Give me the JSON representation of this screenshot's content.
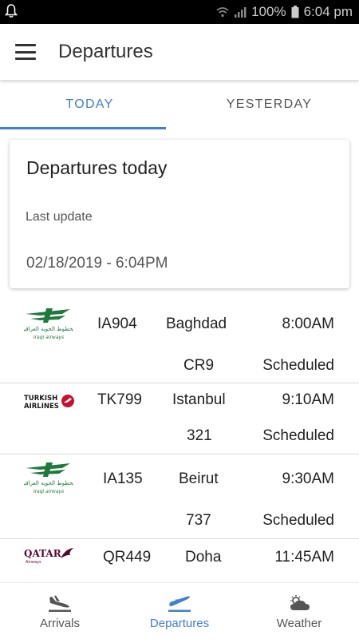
{
  "status_bar": {
    "battery": "100%",
    "time": "6:04 pm"
  },
  "app_bar": {
    "title": "Departures"
  },
  "tabs": [
    {
      "label": "TODAY",
      "active": true
    },
    {
      "label": "YESTERDAY",
      "active": false
    }
  ],
  "card": {
    "title": "Departures today",
    "last_update_label": "Last update",
    "last_update_value": "02/18/2019 - 6:04PM"
  },
  "flights": [
    {
      "airline_logo": "iraqi-airways-logo",
      "flight": "IA904",
      "destination": "Baghdad",
      "time": "8:00AM",
      "aircraft": "CR9",
      "status": "Scheduled"
    },
    {
      "airline_logo": "turkish-airlines-logo",
      "flight": "TK799",
      "destination": "Istanbul",
      "time": "9:10AM",
      "aircraft": "321",
      "status": "Scheduled"
    },
    {
      "airline_logo": "iraqi-airways-logo",
      "flight": "IA135",
      "destination": "Beirut",
      "time": "9:30AM",
      "aircraft": "737",
      "status": "Scheduled"
    },
    {
      "airline_logo": "qatar-airways-logo",
      "flight": "QR449",
      "destination": "Doha",
      "time": "11:45AM",
      "aircraft": "",
      "status": ""
    }
  ],
  "logos": {
    "iraqi": {
      "arabic": "الخطوط الجوية العراقية",
      "english": "Iraqi airways"
    },
    "turkish": {
      "line1": "TURKISH",
      "line2": "AIRLINES"
    },
    "qatar": {
      "name": "QATAR",
      "sub": "Airways"
    }
  },
  "bottom_nav": [
    {
      "label": "Arrivals",
      "icon": "plane-landing-icon",
      "active": false
    },
    {
      "label": "Departures",
      "icon": "plane-takeoff-icon",
      "active": true
    },
    {
      "label": "Weather",
      "icon": "weather-cloud-icon",
      "active": false
    }
  ],
  "colors": {
    "accent": "#3f7fd0",
    "iraqi_green": "#1e7a3c",
    "turkish_red": "#c8102e",
    "qatar_maroon": "#5c0632"
  }
}
